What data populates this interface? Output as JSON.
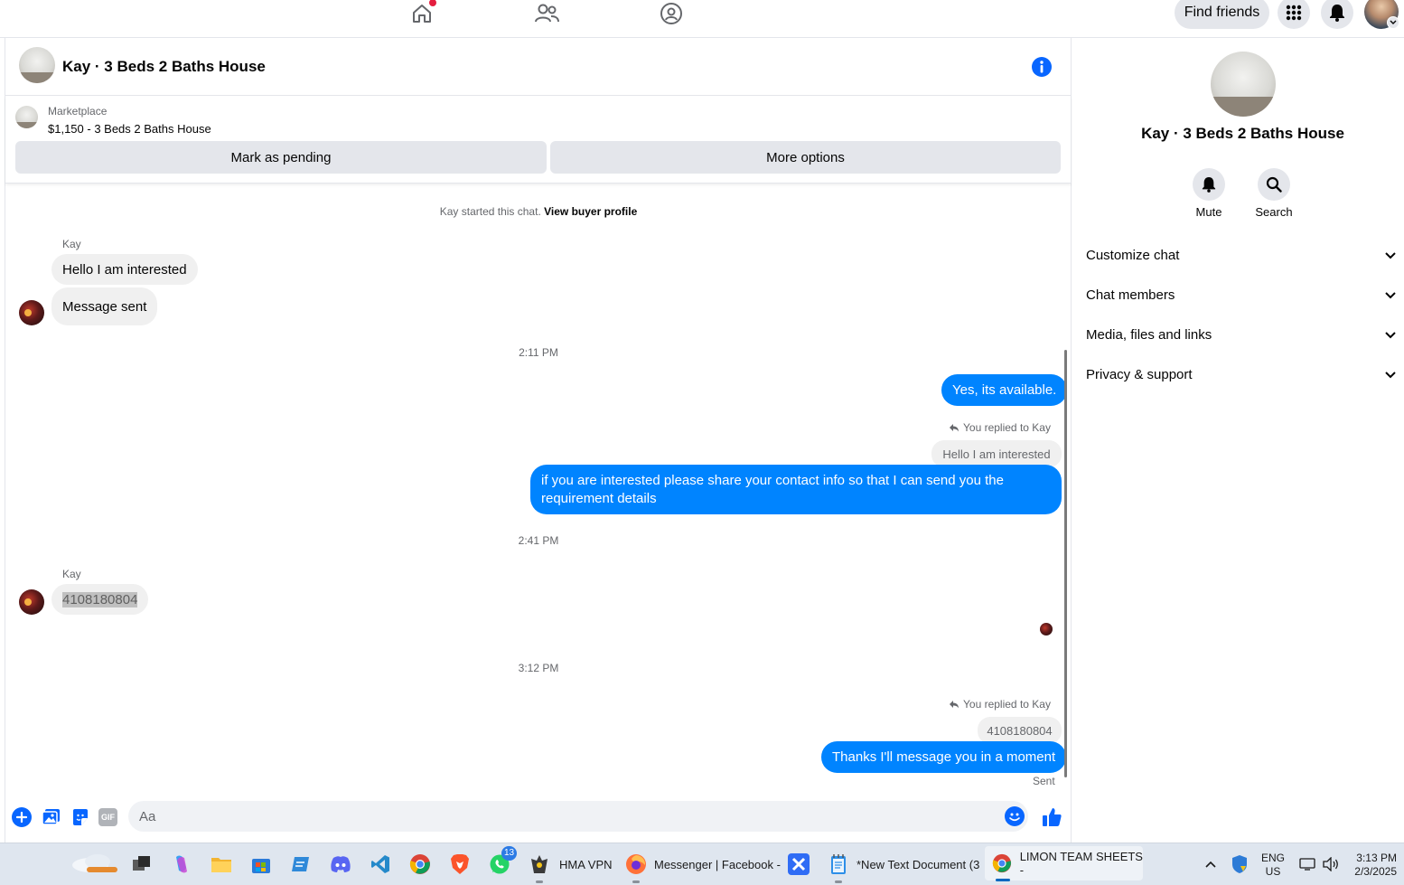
{
  "topnav": {
    "find_friends": "Find friends"
  },
  "chat": {
    "header_title": "Kay · 3 Beds 2 Baths House",
    "market_label": "Marketplace",
    "listing": "$1,150 - 3 Beds 2 Baths House",
    "mark_pending": "Mark as pending",
    "more_options": "More options",
    "started_text": "Kay started this chat.",
    "view_buyer_profile": "View buyer profile",
    "messages": {
      "sender1": "Kay",
      "in1": "Hello I am interested",
      "in2": "Message sent",
      "time1": "2:11 PM",
      "out1": "Yes, its available.",
      "reply_label1": "You replied to Kay",
      "quote1": "Hello I am interested",
      "out2": "if you are interested please share your contact info so that I can send you the requirement details",
      "time2": "2:41 PM",
      "sender2": "Kay",
      "in3": "4108180804",
      "time3": "3:12 PM",
      "reply_label2": "You replied to Kay",
      "quote2": "4108180804",
      "out3": "Thanks I'll message you in a moment",
      "status": "Sent"
    },
    "composer_placeholder": "Aa"
  },
  "rightpanel": {
    "name": "Kay · 3 Beds 2 Baths House",
    "mute": "Mute",
    "search": "Search",
    "sections": [
      "Customize chat",
      "Chat members",
      "Media, files and links",
      "Privacy & support"
    ]
  },
  "taskbar": {
    "hma": "HMA VPN",
    "messenger": "Messenger | Facebook -",
    "textdoc": "*New Text Document (3",
    "limon": "LIMON TEAM SHEETS -",
    "whatsapp_badge": "13",
    "lang1": "ENG",
    "lang2": "US",
    "time": "3:13 PM",
    "date": "2/3/2025"
  },
  "colors": {
    "accent": "#0084ff",
    "fb_blue": "#0866ff",
    "bubble_grey": "#f0f0f0",
    "notify_red": "#e41e3f"
  }
}
